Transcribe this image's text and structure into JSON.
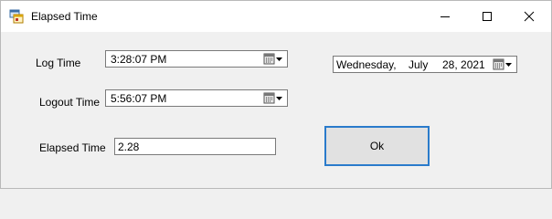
{
  "window": {
    "title": "Elapsed Time",
    "icon": "winforms-app-icon",
    "controls": [
      "minimize-icon",
      "maximize-icon",
      "close-icon"
    ]
  },
  "form": {
    "log_time_label": "Log Time",
    "log_time_value": "3:28:07 PM",
    "logout_time_label": "Logout Time",
    "logout_time_value": "5:56:07 PM",
    "elapsed_time_label": "Elapsed Time",
    "elapsed_time_value": "2.28",
    "date_weekday": "Wednesday,",
    "date_month": "July",
    "date_day_year": "28, 2021",
    "ok_label": "Ok"
  },
  "colors": {
    "focus_border": "#2a7bcb",
    "window_bg": "#f0f0f0"
  }
}
